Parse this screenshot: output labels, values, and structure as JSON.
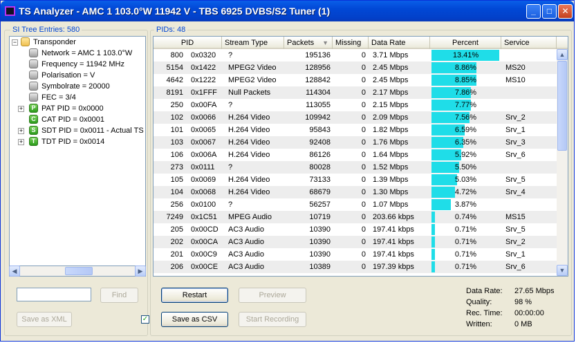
{
  "window": {
    "title": "TS Analyzer - AMC 1 103.0°W 11942 V - TBS 6925 DVBS/S2 Tuner (1)",
    "buttons": {
      "minimize": "_",
      "maximize": "□",
      "close": "✕"
    }
  },
  "si_tree": {
    "label": "SI Tree Entries: 580",
    "items": [
      {
        "text": "Transponder",
        "icon": "folder-icon",
        "expander": "−"
      },
      {
        "text": "Network = AMC 1 103.0°W",
        "icon": "gray-node-icon"
      },
      {
        "text": "Frequency = 11942 MHz",
        "icon": "gray-node-icon"
      },
      {
        "text": "Polarisation = V",
        "icon": "gray-node-icon"
      },
      {
        "text": "Symbolrate = 20000",
        "icon": "gray-node-icon"
      },
      {
        "text": "FEC = 3/4",
        "icon": "gray-node-icon"
      },
      {
        "text": "PAT PID = 0x0000",
        "icon": "P",
        "expander": "+"
      },
      {
        "text": "CAT PID = 0x0001",
        "icon": "C"
      },
      {
        "text": "SDT PID = 0x0011 - Actual TS",
        "icon": "S",
        "expander": "+"
      },
      {
        "text": "TDT PID = 0x0014",
        "icon": "T",
        "expander": "+"
      }
    ],
    "search_value": "",
    "find_button": "Find",
    "save_xml_button": "Save as XML",
    "checkbox_mark": "✓"
  },
  "pids": {
    "label": "PIDs: 48",
    "columns": [
      "PID",
      "Stream Type",
      "Packets",
      "Missing",
      "Data Rate",
      "Percent",
      "Service"
    ],
    "sort_indicator": "▼",
    "rows": [
      {
        "pid": "800",
        "hex": "0x0320",
        "type": "?",
        "packets": "195136",
        "missing": "0",
        "rate": "3.71 Mbps",
        "percent": "13.41%",
        "pct": 13.41,
        "service": ""
      },
      {
        "pid": "5154",
        "hex": "0x1422",
        "type": "MPEG2 Video",
        "packets": "128956",
        "missing": "0",
        "rate": "2.45 Mbps",
        "percent": "8.86%",
        "pct": 8.86,
        "service": "MS20"
      },
      {
        "pid": "4642",
        "hex": "0x1222",
        "type": "MPEG2 Video",
        "packets": "128842",
        "missing": "0",
        "rate": "2.45 Mbps",
        "percent": "8.85%",
        "pct": 8.85,
        "service": "MS10"
      },
      {
        "pid": "8191",
        "hex": "0x1FFF",
        "type": "Null Packets",
        "packets": "114304",
        "missing": "0",
        "rate": "2.17 Mbps",
        "percent": "7.86%",
        "pct": 7.86,
        "service": ""
      },
      {
        "pid": "250",
        "hex": "0x00FA",
        "type": "?",
        "packets": "113055",
        "missing": "0",
        "rate": "2.15 Mbps",
        "percent": "7.77%",
        "pct": 7.77,
        "service": ""
      },
      {
        "pid": "102",
        "hex": "0x0066",
        "type": "H.264 Video",
        "packets": "109942",
        "missing": "0",
        "rate": "2.09 Mbps",
        "percent": "7.56%",
        "pct": 7.56,
        "service": "Srv_2"
      },
      {
        "pid": "101",
        "hex": "0x0065",
        "type": "H.264 Video",
        "packets": "95843",
        "missing": "0",
        "rate": "1.82 Mbps",
        "percent": "6.59%",
        "pct": 6.59,
        "service": "Srv_1"
      },
      {
        "pid": "103",
        "hex": "0x0067",
        "type": "H.264 Video",
        "packets": "92408",
        "missing": "0",
        "rate": "1.76 Mbps",
        "percent": "6.35%",
        "pct": 6.35,
        "service": "Srv_3"
      },
      {
        "pid": "106",
        "hex": "0x006A",
        "type": "H.264 Video",
        "packets": "86126",
        "missing": "0",
        "rate": "1.64 Mbps",
        "percent": "5.92%",
        "pct": 5.92,
        "service": "Srv_6"
      },
      {
        "pid": "273",
        "hex": "0x0111",
        "type": "?",
        "packets": "80028",
        "missing": "0",
        "rate": "1.52 Mbps",
        "percent": "5.50%",
        "pct": 5.5,
        "service": ""
      },
      {
        "pid": "105",
        "hex": "0x0069",
        "type": "H.264 Video",
        "packets": "73133",
        "missing": "0",
        "rate": "1.39 Mbps",
        "percent": "5.03%",
        "pct": 5.03,
        "service": "Srv_5"
      },
      {
        "pid": "104",
        "hex": "0x0068",
        "type": "H.264 Video",
        "packets": "68679",
        "missing": "0",
        "rate": "1.30 Mbps",
        "percent": "4.72%",
        "pct": 4.72,
        "service": "Srv_4"
      },
      {
        "pid": "256",
        "hex": "0x0100",
        "type": "?",
        "packets": "56257",
        "missing": "0",
        "rate": "1.07 Mbps",
        "percent": "3.87%",
        "pct": 3.87,
        "service": ""
      },
      {
        "pid": "7249",
        "hex": "0x1C51",
        "type": "MPEG Audio",
        "packets": "10719",
        "missing": "0",
        "rate": "203.66 kbps",
        "percent": "0.74%",
        "pct": 0.74,
        "service": "MS15"
      },
      {
        "pid": "205",
        "hex": "0x00CD",
        "type": "AC3 Audio",
        "packets": "10390",
        "missing": "0",
        "rate": "197.41 kbps",
        "percent": "0.71%",
        "pct": 0.71,
        "service": "Srv_5"
      },
      {
        "pid": "202",
        "hex": "0x00CA",
        "type": "AC3 Audio",
        "packets": "10390",
        "missing": "0",
        "rate": "197.41 kbps",
        "percent": "0.71%",
        "pct": 0.71,
        "service": "Srv_2"
      },
      {
        "pid": "201",
        "hex": "0x00C9",
        "type": "AC3 Audio",
        "packets": "10390",
        "missing": "0",
        "rate": "197.41 kbps",
        "percent": "0.71%",
        "pct": 0.71,
        "service": "Srv_1"
      },
      {
        "pid": "206",
        "hex": "0x00CE",
        "type": "AC3 Audio",
        "packets": "10389",
        "missing": "0",
        "rate": "197.39 kbps",
        "percent": "0.71%",
        "pct": 0.71,
        "service": "Srv_6"
      }
    ]
  },
  "buttons": {
    "restart": "Restart",
    "preview": "Preview",
    "save_csv": "Save as CSV",
    "start_recording": "Start Recording"
  },
  "stats": [
    {
      "label": "Data Rate:",
      "value": "27.65 Mbps"
    },
    {
      "label": "Quality:",
      "value": "98 %"
    },
    {
      "label": "Rec. Time:",
      "value": "00:00:00"
    },
    {
      "label": "Written:",
      "value": "0 MB"
    }
  ],
  "colors": {
    "bar": "#1fdde8",
    "title_bar": "#0148d6",
    "group_label": "#0046d5"
  }
}
